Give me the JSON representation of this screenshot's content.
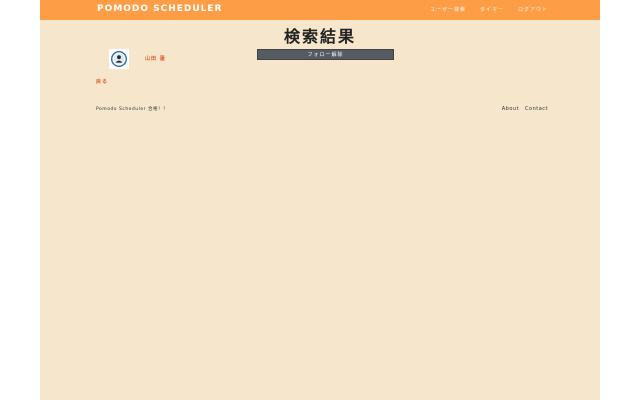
{
  "navbar": {
    "brand": "POMODO SCHEDULER",
    "links": [
      "ユーザー検索",
      "タイマー",
      "ログアウト"
    ]
  },
  "page_title": "検索結果",
  "follow_button": "フォロー解除",
  "user": {
    "name": "山田 蓮"
  },
  "back_link": "戻る",
  "footer": {
    "copyright": "Pomodo Scheduler 合格！！",
    "links": [
      "About",
      "Contact"
    ]
  },
  "colors": {
    "navbar": "#fd9e46",
    "background": "#f5e6cc",
    "accent": "#e0612a",
    "button": "#555b60"
  }
}
